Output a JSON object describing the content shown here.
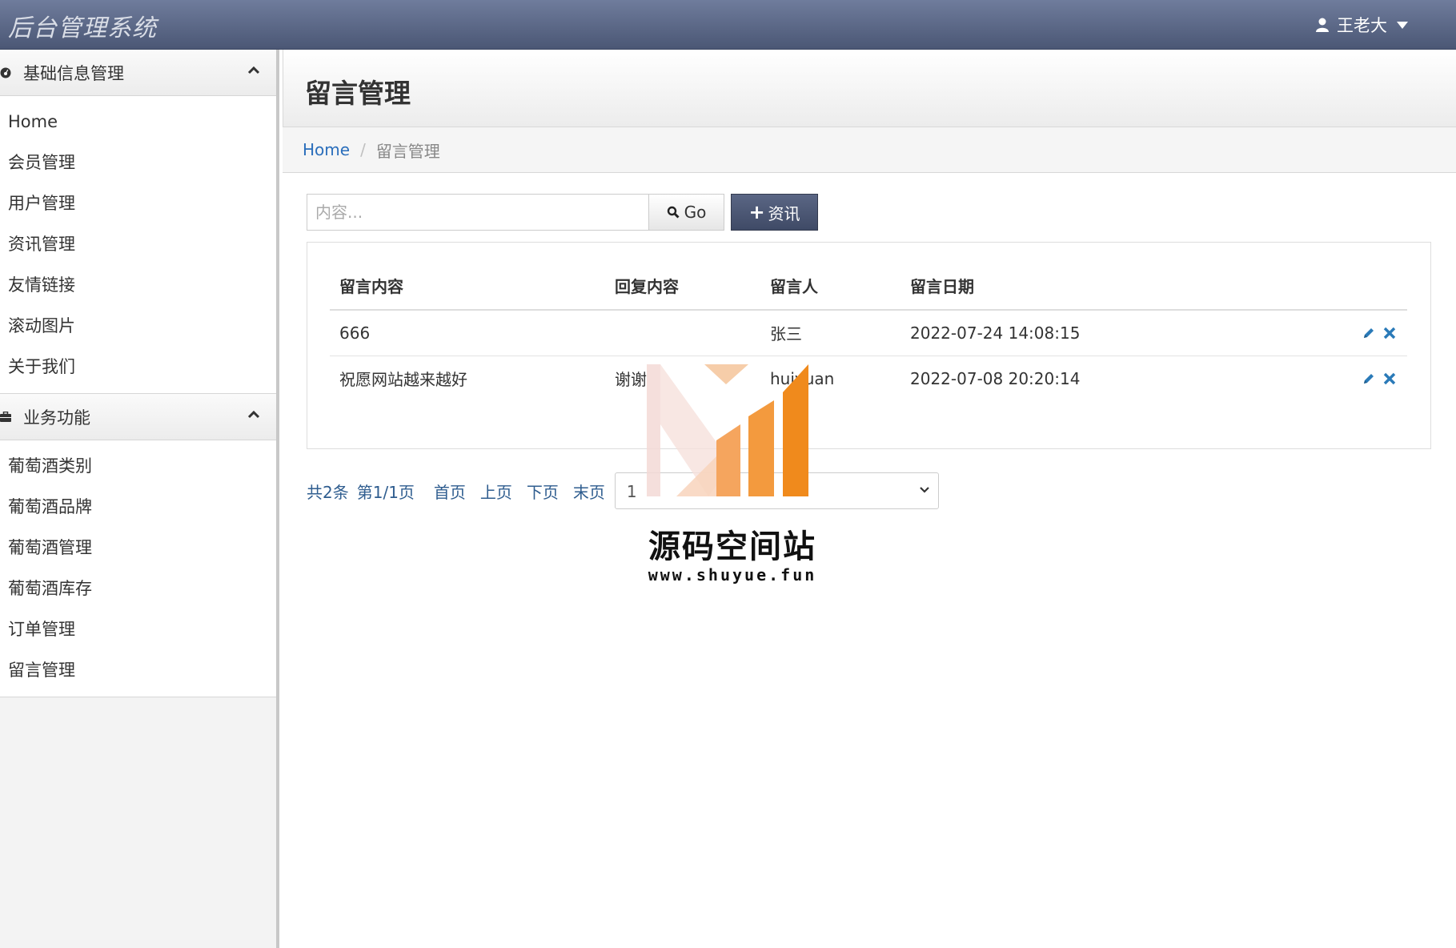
{
  "app": {
    "brand": "后台管理系统"
  },
  "user": {
    "name": "王老大"
  },
  "sidebar": {
    "groups": [
      {
        "title": "基础信息管理",
        "items": [
          {
            "label": "Home"
          },
          {
            "label": "会员管理"
          },
          {
            "label": "用户管理"
          },
          {
            "label": "资讯管理"
          },
          {
            "label": "友情链接"
          },
          {
            "label": "滚动图片"
          },
          {
            "label": "关于我们"
          }
        ]
      },
      {
        "title": "业务功能",
        "items": [
          {
            "label": "葡萄酒类别"
          },
          {
            "label": "葡萄酒品牌"
          },
          {
            "label": "葡萄酒管理"
          },
          {
            "label": "葡萄酒库存"
          },
          {
            "label": "订单管理"
          },
          {
            "label": "留言管理"
          }
        ]
      }
    ]
  },
  "page": {
    "title": "留言管理",
    "breadcrumb": {
      "home": "Home",
      "current": "留言管理"
    }
  },
  "toolbar": {
    "search_placeholder": "内容...",
    "go_label": "Go",
    "add_label": "资讯"
  },
  "table": {
    "headers": [
      "留言内容",
      "回复内容",
      "留言人",
      "留言日期"
    ],
    "rows": [
      {
        "content": "666",
        "reply": "",
        "author": "张三",
        "date": "2022-07-24 14:08:15"
      },
      {
        "content": "祝愿网站越来越好",
        "reply": "谢谢",
        "author": "huiyuan",
        "date": "2022-07-08 20:20:14"
      }
    ]
  },
  "pager": {
    "total": "共2条",
    "page_info": "第1/1页",
    "first": "首页",
    "prev": "上页",
    "next": "下页",
    "last": "末页",
    "select_value": "1"
  },
  "watermark": {
    "text": "源码空间站",
    "url": "www.shuyue.fun"
  },
  "colors": {
    "navbar": "#5a6684",
    "link": "#2a6ebb",
    "action_icon": "#2a7ab8",
    "accent_orange": "#f08a1c"
  }
}
